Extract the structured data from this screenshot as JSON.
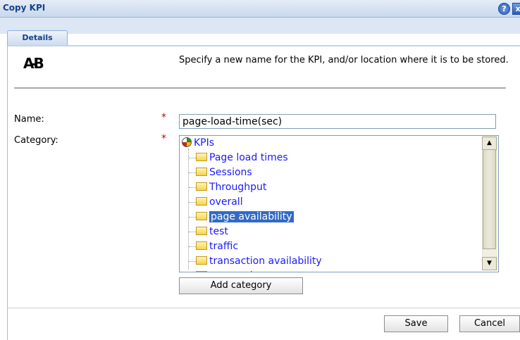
{
  "window": {
    "title": "Copy KPI",
    "help_label": "?",
    "close_label": "x"
  },
  "tabs": [
    {
      "label": "Details"
    }
  ],
  "logo": {
    "text": "AB"
  },
  "instructions": "Specify a new name for the KPI, and/or location where it is to be stored.",
  "form": {
    "name_label": "Name:",
    "name_value": "page-load-time(sec)",
    "category_label": "Category:",
    "required_mark": "*"
  },
  "tree": {
    "root": "KPIs",
    "items": [
      {
        "label": "Page load times",
        "selected": false
      },
      {
        "label": "Sessions",
        "selected": false
      },
      {
        "label": "Throughput",
        "selected": false
      },
      {
        "label": "overall",
        "selected": false
      },
      {
        "label": "page availability",
        "selected": true
      },
      {
        "label": "test",
        "selected": false
      },
      {
        "label": "traffic",
        "selected": false
      },
      {
        "label": "transaction availability",
        "selected": false
      },
      {
        "label": "transactions",
        "selected": false
      }
    ]
  },
  "buttons": {
    "add_category": "Add category",
    "save": "Save",
    "cancel": "Cancel"
  }
}
